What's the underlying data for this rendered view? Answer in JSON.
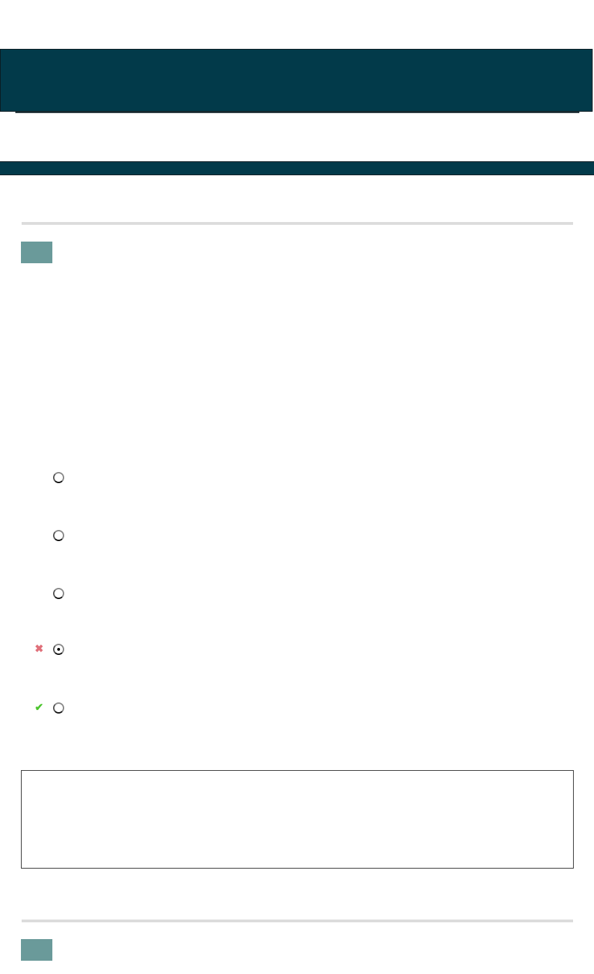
{
  "colors": {
    "header_bg": "#023a4a",
    "question_badge_bg": "#6a9a9a",
    "divider": "#dcdcdc",
    "wrong_mark": "#e0707a",
    "right_mark": "#4cc52e"
  },
  "questions": [
    {
      "number": "",
      "text": "",
      "options": [
        {
          "label": "",
          "selected": false,
          "mark": ""
        },
        {
          "label": "",
          "selected": false,
          "mark": ""
        },
        {
          "label": "",
          "selected": false,
          "mark": ""
        },
        {
          "label": "",
          "selected": true,
          "mark": "wrong-icon"
        },
        {
          "label": "",
          "selected": false,
          "mark": "check-icon"
        }
      ],
      "feedback": ""
    },
    {
      "number": ""
    }
  ],
  "icons": {
    "wrong": "✖",
    "right": "✔"
  }
}
